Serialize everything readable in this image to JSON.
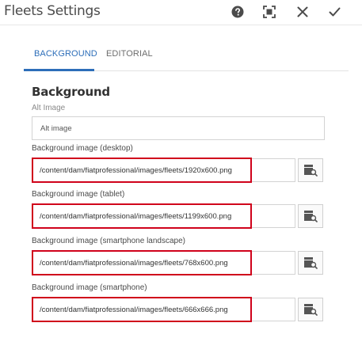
{
  "dialog": {
    "title": "Fleets Settings",
    "header_icons": [
      "help-icon",
      "fullscreen-icon",
      "close-icon",
      "checkmark-icon"
    ]
  },
  "tabs": [
    {
      "label": "BACKGROUND",
      "active": true
    },
    {
      "label": "EDITORIAL",
      "active": false
    }
  ],
  "section": {
    "title": "Background"
  },
  "fields": {
    "alt_image": {
      "label": "Alt Image",
      "value": "Alt image"
    },
    "desktop": {
      "label": "Background image (desktop)",
      "value": "/content/dam/fiatprofessional/images/fleets/1920x600.png"
    },
    "tablet": {
      "label": "Background image (tablet)",
      "value": "/content/dam/fiatprofessional/images/fleets/1199x600.png"
    },
    "landscape": {
      "label": "Background image (smartphone landscape)",
      "value": "/content/dam/fiatprofessional/images/fleets/768x600.png"
    },
    "smartphone": {
      "label": "Background image (smartphone)",
      "value": "/content/dam/fiatprofessional/images/fleets/666x666.png"
    }
  },
  "colors": {
    "accent": "#2d6eb9",
    "highlight_border": "#d0021b"
  }
}
